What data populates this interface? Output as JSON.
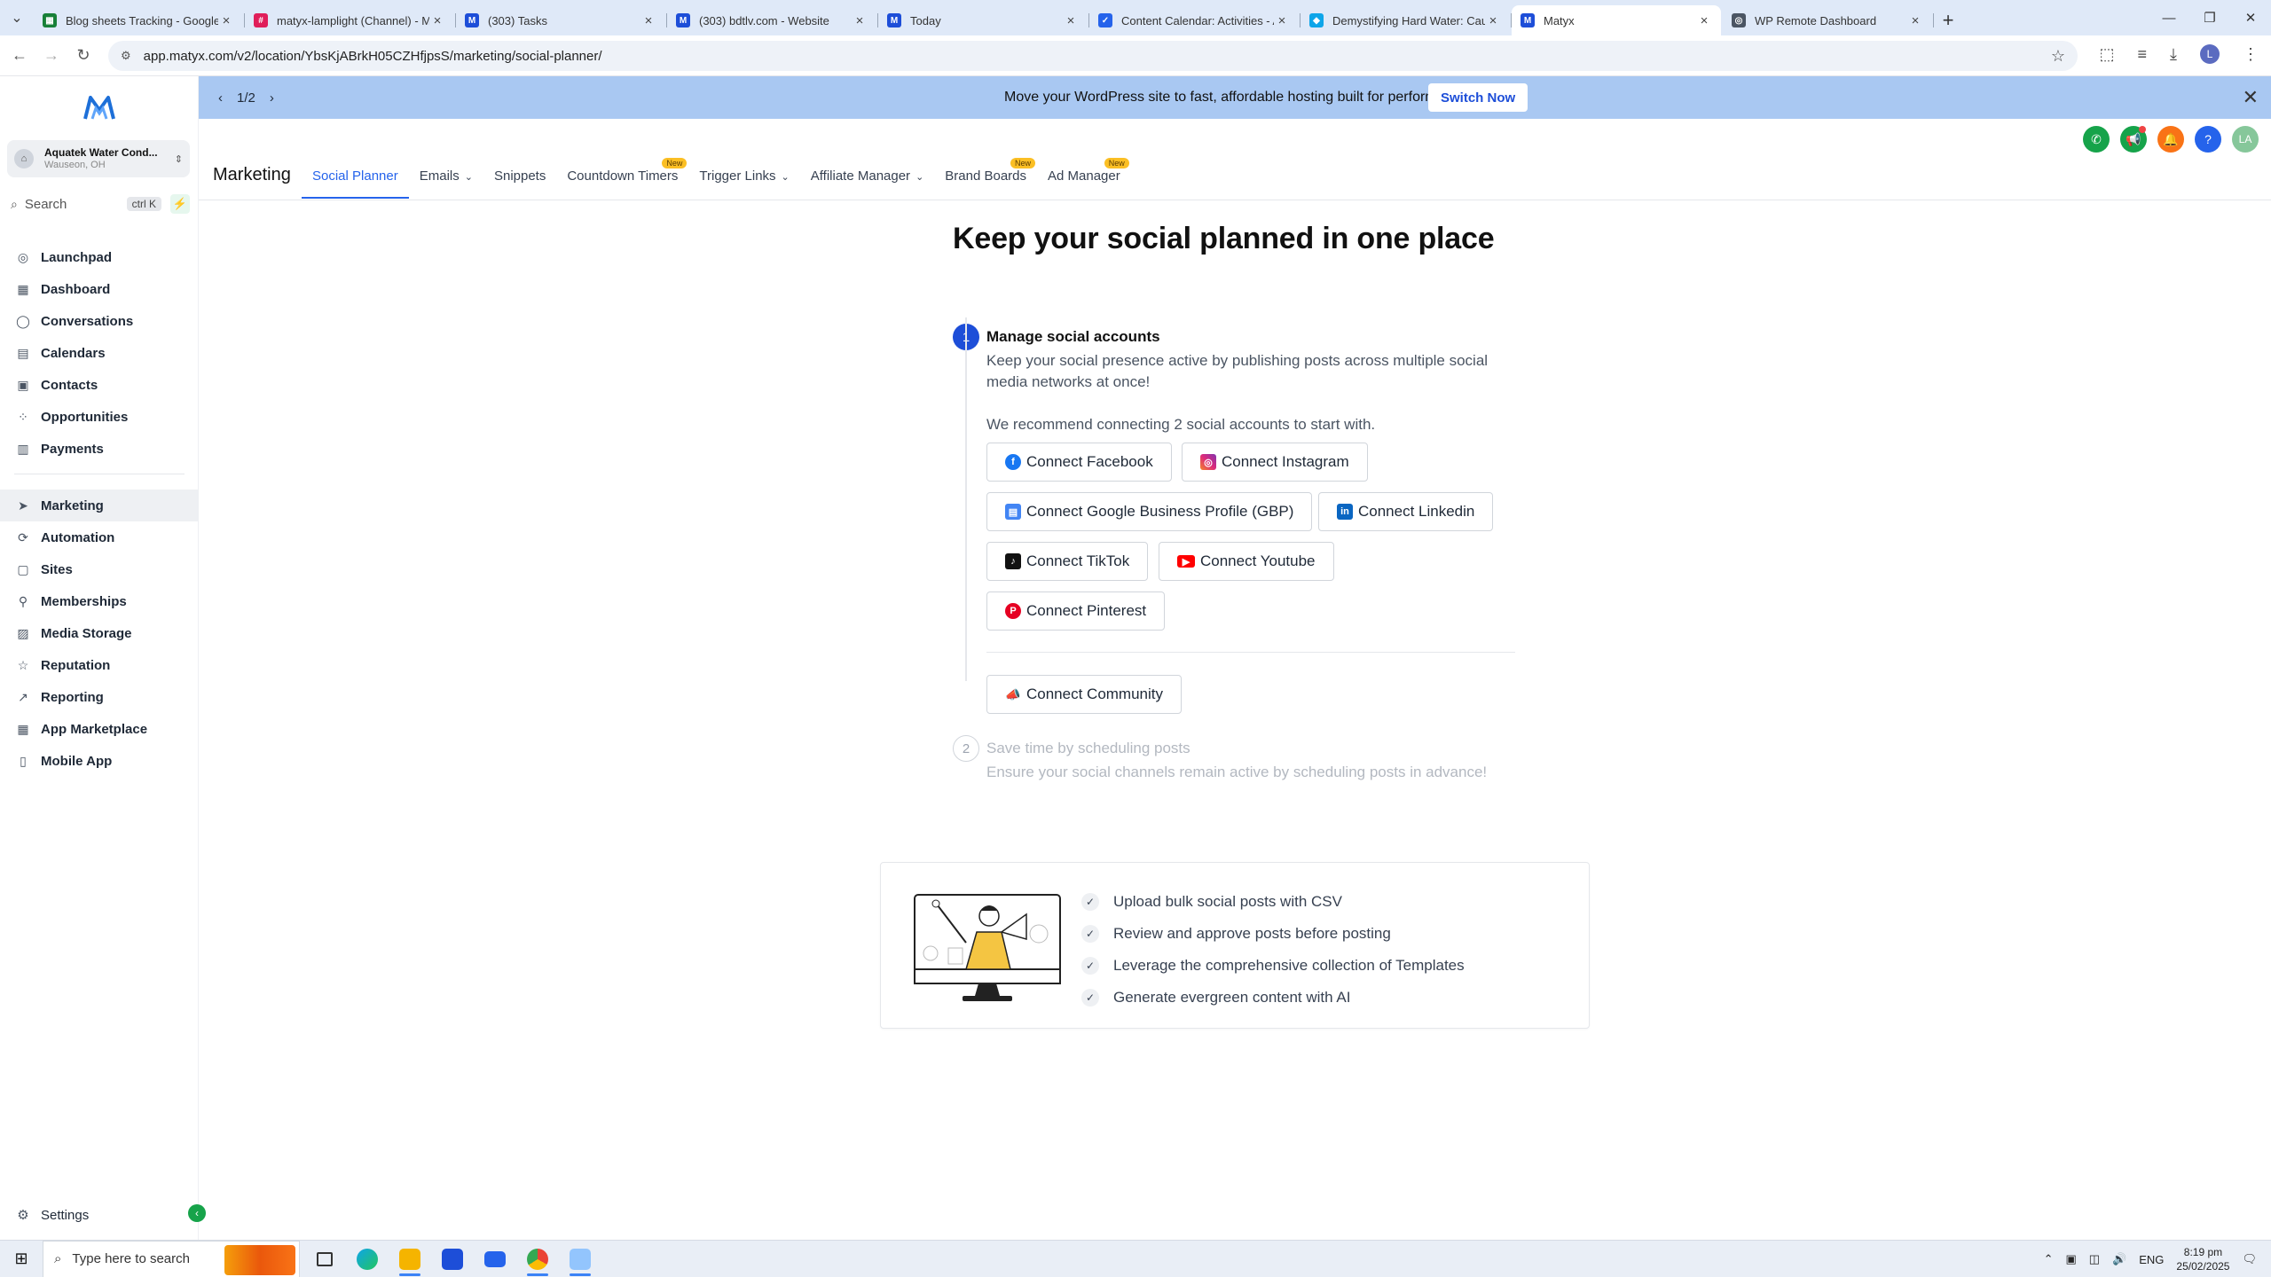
{
  "browser": {
    "tabs": [
      {
        "title": "Blog sheets Tracking - Google S",
        "fav_color": "#188038",
        "fav_glyph": "▦"
      },
      {
        "title": "matyx-lamplight (Channel) - M",
        "fav_color": "#e01e5a",
        "fav_glyph": "#"
      },
      {
        "title": "(303) Tasks",
        "fav_color": "#1d4ed8",
        "fav_glyph": "M"
      },
      {
        "title": "(303) bdtlv.com - Website",
        "fav_color": "#1d4ed8",
        "fav_glyph": "M"
      },
      {
        "title": "Today",
        "fav_color": "#1d4ed8",
        "fav_glyph": "M"
      },
      {
        "title": "Content Calendar: Activities - A",
        "fav_color": "#2563eb",
        "fav_glyph": "✓"
      },
      {
        "title": "Demystifying Hard Water: Caus",
        "fav_color": "#0ea5e9",
        "fav_glyph": "◆"
      },
      {
        "title": "Matyx",
        "fav_color": "#1d4ed8",
        "fav_glyph": "M"
      },
      {
        "title": "WP Remote Dashboard",
        "fav_color": "#4b5563",
        "fav_glyph": "◎"
      }
    ],
    "url": "app.matyx.com/v2/location/YbsKjABrkH05CZHfjpsS/marketing/social-planner/"
  },
  "sidebar": {
    "location_name": "Aquatek Water Cond...",
    "location_sub": "Wauseon, OH",
    "search_label": "Search",
    "search_shortcut": "ctrl K",
    "items": [
      {
        "label": "Launchpad",
        "icon": "rocket-icon"
      },
      {
        "label": "Dashboard",
        "icon": "grid-icon"
      },
      {
        "label": "Conversations",
        "icon": "chat-icon"
      },
      {
        "label": "Calendars",
        "icon": "calendar-icon"
      },
      {
        "label": "Contacts",
        "icon": "contacts-icon"
      },
      {
        "label": "Opportunities",
        "icon": "pipeline-icon"
      },
      {
        "label": "Payments",
        "icon": "payments-icon"
      }
    ],
    "items2": [
      {
        "label": "Marketing",
        "icon": "send-icon"
      },
      {
        "label": "Automation",
        "icon": "automation-icon"
      },
      {
        "label": "Sites",
        "icon": "sites-icon"
      },
      {
        "label": "Memberships",
        "icon": "memberships-icon"
      },
      {
        "label": "Media Storage",
        "icon": "media-icon"
      },
      {
        "label": "Reputation",
        "icon": "star-icon"
      },
      {
        "label": "Reporting",
        "icon": "chart-icon"
      },
      {
        "label": "App Marketplace",
        "icon": "apps-icon"
      },
      {
        "label": "Mobile App",
        "icon": "phone-icon"
      }
    ],
    "settings_label": "Settings"
  },
  "banner": {
    "pager": "1/2",
    "message": "Move your WordPress site to fast, affordable hosting built for performance!",
    "cta": "Switch Now"
  },
  "topnav": {
    "brand": "Marketing",
    "tabs": [
      {
        "label": "Social Planner",
        "active": true
      },
      {
        "label": "Emails",
        "chevron": true
      },
      {
        "label": "Snippets"
      },
      {
        "label": "Countdown Timers",
        "badge": "New"
      },
      {
        "label": "Trigger Links",
        "chevron": true
      },
      {
        "label": "Affiliate Manager",
        "chevron": true
      },
      {
        "label": "Brand Boards",
        "badge": "New"
      },
      {
        "label": "Ad Manager",
        "badge": "New"
      }
    ],
    "user_initials": "LA"
  },
  "main": {
    "headline": "Keep your social planned in one place",
    "step1": {
      "num": "1",
      "title": "Manage social accounts",
      "desc": "Keep your social presence active by publishing posts across multiple social media networks at once!",
      "recommend": "We recommend connecting 2 social accounts to start with.",
      "buttons": {
        "facebook": "Connect Facebook",
        "instagram": "Connect Instagram",
        "gbp": "Connect Google Business Profile (GBP)",
        "linkedin": "Connect Linkedin",
        "tiktok": "Connect TikTok",
        "youtube": "Connect Youtube",
        "pinterest": "Connect Pinterest",
        "community": "Connect Community"
      }
    },
    "step2": {
      "num": "2",
      "title": "Save time by scheduling posts",
      "desc": "Ensure your social channels remain active by scheduling posts in advance!"
    }
  },
  "features": [
    "Upload bulk social posts with CSV",
    "Review and approve posts before posting",
    "Leverage the comprehensive collection of Templates",
    "Generate evergreen content with AI"
  ],
  "taskbar": {
    "search_placeholder": "Type here to search",
    "lang": "ENG",
    "time": "8:19 pm",
    "date": "25/02/2025"
  },
  "colors": {
    "accent": "#2563eb",
    "banner": "#a9c8f2",
    "facebook": "#1877f2",
    "linkedin": "#0a66c2",
    "youtube": "#ff0000",
    "pinterest": "#e60023"
  }
}
